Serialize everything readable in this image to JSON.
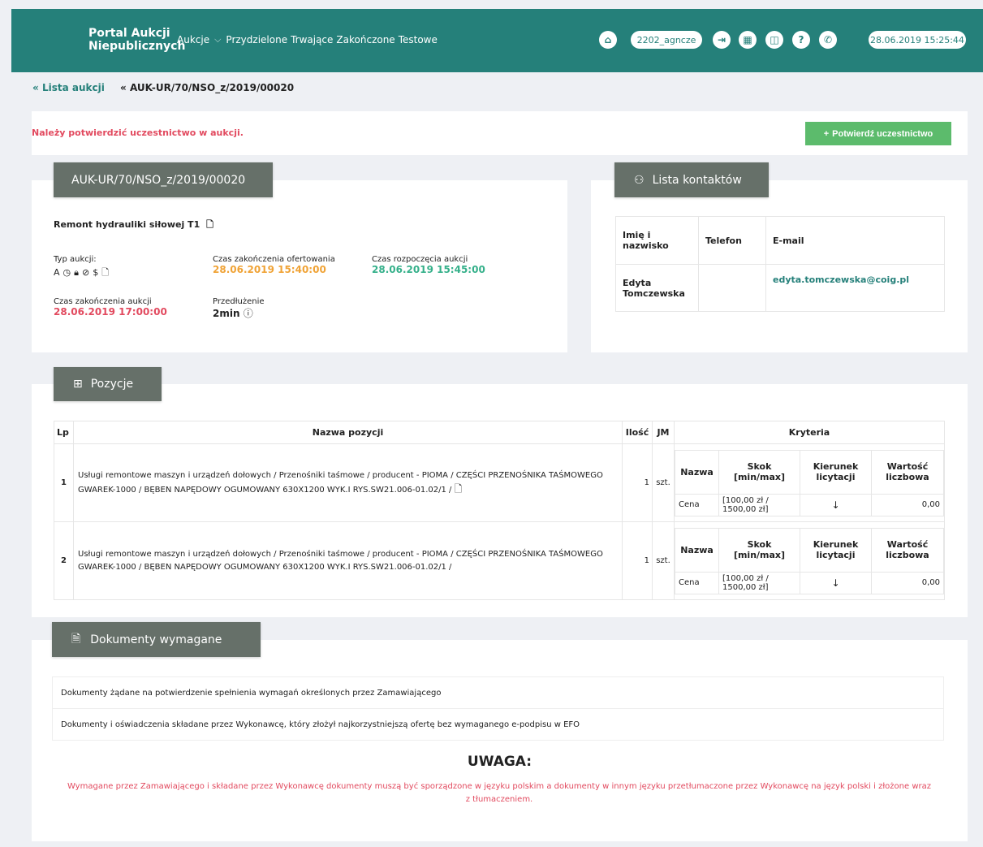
{
  "header": {
    "brand": "Portal Aukcji Niepublicznych",
    "brand_line1": "Portal Aukcji",
    "brand_line2": "Niepublicznych",
    "nav": [
      "Aukcje",
      "Przydzielone",
      "Trwające",
      "Zakończone",
      "Testowe"
    ],
    "user": "2202_agncze",
    "datetime": "28.06.2019 15:25:44"
  },
  "breadcrumb": {
    "list": "Lista aukcji",
    "current": "AUK-UR/70/NSO_z/2019/00020"
  },
  "alert": {
    "message": "Należy potwierdzić uczestnictwo w aukcji.",
    "button": "Potwierdź uczestnictwo"
  },
  "auction": {
    "code": "AUK-UR/70/NSO_z/2019/00020",
    "title": "Remont hydrauliki siłowej T1",
    "type_label": "Typ aukcji:",
    "offer_end_label": "Czas zakończenia ofertowania",
    "offer_end": "28.06.2019 15:40:00",
    "auction_start_label": "Czas rozpoczęcia aukcji",
    "auction_start": "28.06.2019 15:45:00",
    "auction_end_label": "Czas zakończenia aukcji",
    "auction_end": "28.06.2019 17:00:00",
    "extension_label": "Przedłużenie",
    "extension": "2min"
  },
  "contacts": {
    "tab_label": "Lista kontaktów",
    "headers": [
      "Imię i nazwisko",
      "Telefon",
      "E-mail"
    ],
    "rows": [
      {
        "name": "Edyta Tomczewska",
        "phone": "",
        "email": "edyta.tomczewska@coig.pl"
      }
    ]
  },
  "positions": {
    "tab_label": "Pozycje",
    "headers": {
      "lp": "Lp",
      "name": "Nazwa pozycji",
      "qty": "Ilość",
      "unit": "JM",
      "criteria": "Kryteria"
    },
    "criteria_headers": [
      "Nazwa",
      "Skok [min/max]",
      "Kierunek licytacji",
      "Wartość liczbowa"
    ],
    "rows": [
      {
        "lp": "1",
        "name": "Usługi remontowe maszyn i urządzeń dołowych / Przenośniki taśmowe / producent - PIOMA / CZĘŚCI PRZENOŚNIKA TAŚMOWEGO GWAREK-1000 / BĘBEN NAPĘDOWY OGUMOWANY 630X1200 WYK.I RYS.SW21.006-01.02/1 /",
        "qty": "1",
        "unit": "szt.",
        "crit_name": "Cena",
        "crit_step": "[100,00 zł / 1500,00 zł]",
        "crit_dir": "↓",
        "crit_value": "0,00"
      },
      {
        "lp": "2",
        "name": "Usługi remontowe maszyn i urządzeń dołowych / Przenośniki taśmowe / producent - PIOMA / CZĘŚCI PRZENOŚNIKA TAŚMOWEGO GWAREK-1000 / BĘBEN NAPĘDOWY OGUMOWANY 630X1200 WYK.I RYS.SW21.006-01.02/1 /",
        "qty": "1",
        "unit": "szt.",
        "crit_name": "Cena",
        "crit_step": "[100,00 zł / 1500,00 zł]",
        "crit_dir": "↓",
        "crit_value": "0,00"
      }
    ]
  },
  "documents": {
    "tab_label": "Dokumenty wymagane",
    "items": [
      "Dokumenty żądane na potwierdzenie spełnienia wymagań określonych przez Zamawiającego",
      "Dokumenty i oświadczenia składane przez Wykonawcę, który złożył najkorzystniejszą ofertę bez wymaganego e-podpisu w EFO"
    ],
    "warning_title": "UWAGA:",
    "warning_text": "Wymagane przez Zamawiającego i składane przez Wykonawcę dokumenty muszą być sporządzone w języku polskim a dokumenty w innym języku przetłumaczone przez Wykonawcę na język polski i złożone wraz z tłumaczeniem."
  },
  "colors": {
    "header_bg": "#25807a",
    "tab_bg": "#667069",
    "accent_green": "#5cbb6c",
    "alert_red": "#e24a5f",
    "orange": "#f0a336",
    "teal": "#35b08a"
  }
}
